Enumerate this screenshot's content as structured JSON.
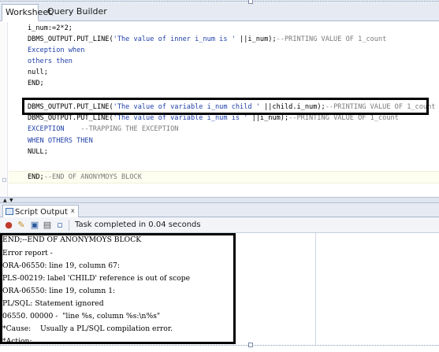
{
  "tabs": [
    {
      "label": "Worksheet"
    },
    {
      "label": "Query Builder"
    }
  ],
  "editor": {
    "lines": [
      [
        {
          "t": "i_num:=2*2;",
          "c": ""
        }
      ],
      [
        {
          "t": "DBMS_OUTPUT.PUT_LINE(",
          "c": ""
        },
        {
          "t": "'The value of inner i_num is '",
          "c": "str"
        },
        {
          "t": " ||i_num);",
          "c": ""
        },
        {
          "t": "--PRINTING VALUE OF 1_count",
          "c": "cmt"
        }
      ],
      [
        {
          "t": "Exception when",
          "c": "kw"
        }
      ],
      [
        {
          "t": "others then",
          "c": "kw"
        }
      ],
      [
        {
          "t": "null;",
          "c": ""
        }
      ],
      [
        {
          "t": "END;",
          "c": ""
        }
      ],
      [
        {
          "t": "",
          "c": ""
        }
      ],
      [
        {
          "t": "DBMS_OUTPUT.PUT_LINE(",
          "c": ""
        },
        {
          "t": "'The value of variable i_num child '",
          "c": "str"
        },
        {
          "t": " ||child.i_num);",
          "c": ""
        },
        {
          "t": "--PRINTING VALUE OF 1_count",
          "c": "cmt"
        }
      ],
      [
        {
          "t": "DBMS_OUTPUT.PUT_LINE(",
          "c": ""
        },
        {
          "t": "'The value of variable i_num is '",
          "c": "str"
        },
        {
          "t": " ||i_num);",
          "c": ""
        },
        {
          "t": "--PRINTING VALUE OF 1_count",
          "c": "cmt"
        }
      ],
      [
        {
          "t": "EXCEPTION",
          "c": "kw"
        },
        {
          "t": "    --TRAPPING THE EXCEPTION",
          "c": "cmt"
        }
      ],
      [
        {
          "t": "WHEN OTHERS THEN",
          "c": "kw"
        }
      ],
      [
        {
          "t": "NULL;",
          "c": ""
        }
      ],
      [
        {
          "t": "",
          "c": ""
        }
      ],
      [
        {
          "t": "END;",
          "c": ""
        },
        {
          "t": "--END OF ANONYMOYS BLOCK",
          "c": "cmt"
        }
      ]
    ]
  },
  "output_panel": {
    "tab_label": "Script Output",
    "tab_close": "x",
    "status": "Task completed in 0.04 seconds",
    "lines": [
      "END;--END OF ANONYMOYS BLOCK",
      "Error report -",
      "ORA-06550: line 19, column 67:",
      "PLS-00219: label 'CHILD' reference is out of scope",
      "ORA-06550: line 19, column 1:",
      "PL/SQL: Statement ignored",
      "06550. 00000 -  \"line %s, column %s:\\n%s\"",
      "*Cause:    Usually a PL/SQL compilation error.",
      "*Action:"
    ]
  },
  "icons": {
    "pin": "pin-icon",
    "eraser": "eraser-icon",
    "save": "save-icon",
    "print": "print-icon",
    "document": "document-icon"
  },
  "colors": {
    "keyword": "#1f3fa8",
    "comment": "#7b7b7b",
    "highlight_box": "#000000"
  }
}
